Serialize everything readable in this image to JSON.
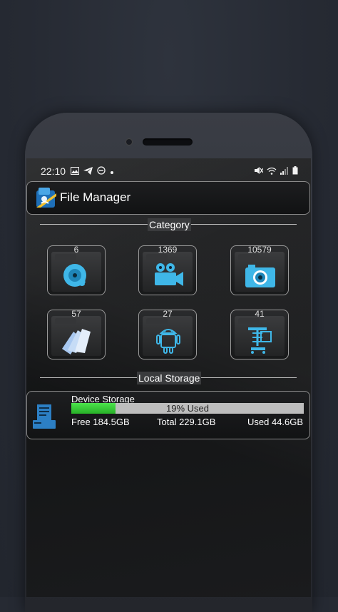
{
  "status_bar": {
    "time": "22:10",
    "left_icons": [
      "image-icon",
      "telegram-icon",
      "do-not-disturb-icon",
      "dot-icon"
    ],
    "right_icons": [
      "mute-icon",
      "wifi-icon",
      "signal-icon",
      "battery-icon"
    ]
  },
  "header": {
    "title": "File Manager",
    "logo_icon": "file-manager-logo-icon"
  },
  "category": {
    "label": "Category",
    "tiles": [
      {
        "name": "music",
        "count": "6",
        "icon": "music-disc-icon"
      },
      {
        "name": "video",
        "count": "1369",
        "icon": "video-camera-icon"
      },
      {
        "name": "photo",
        "count": "10579",
        "icon": "photo-camera-icon"
      },
      {
        "name": "documents",
        "count": "57",
        "icon": "documents-icon"
      },
      {
        "name": "apps",
        "count": "27",
        "icon": "android-icon"
      },
      {
        "name": "archives",
        "count": "41",
        "icon": "zip-archive-icon"
      }
    ]
  },
  "local_storage": {
    "label": "Local Storage",
    "device": {
      "name": "Device Storage",
      "used_percent_label": "19% Used",
      "used_fraction": 0.19,
      "free": "Free 184.5GB",
      "total": "Total 229.1GB",
      "used": "Used 44.6GB",
      "icon": "device-storage-icon"
    }
  },
  "colors": {
    "accent_blue": "#3fb7e8",
    "progress_green": "#3ccd3c"
  }
}
